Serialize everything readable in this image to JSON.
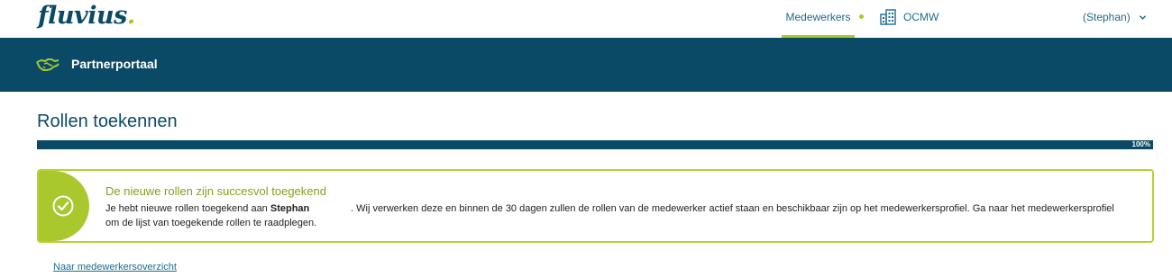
{
  "header": {
    "logo_text": "fluvius",
    "logo_dot": ".",
    "nav_active": "Medewerkers",
    "org_label": "OCMW",
    "user_menu": "(Stephan)",
    "accent_color": "#a8c82e",
    "brand_color": "#0b4a66"
  },
  "banner": {
    "title": "Partnerportaal",
    "icon": "handshake-icon"
  },
  "page": {
    "title": "Rollen toekennen",
    "progress_value": 1.0,
    "progress_label": "100%"
  },
  "alert": {
    "icon": "check-circle-icon",
    "heading": "De nieuwe rollen zijn succesvol toegekend",
    "text_prefix": "Je hebt nieuwe rollen toegekend aan ",
    "name": "Stephan",
    "text_line1_rest": ". Wij verwerken deze en binnen de 30 dagen zullen de rollen van de medewerker actief staan en beschikbaar zijn op het medewerkersprofiel. Ga naar het medewerkersprofiel",
    "text_line2": "om de lijst van toegekende rollen te raadplegen."
  },
  "footer": {
    "back_link": "Naar medewerkersoverzicht"
  }
}
